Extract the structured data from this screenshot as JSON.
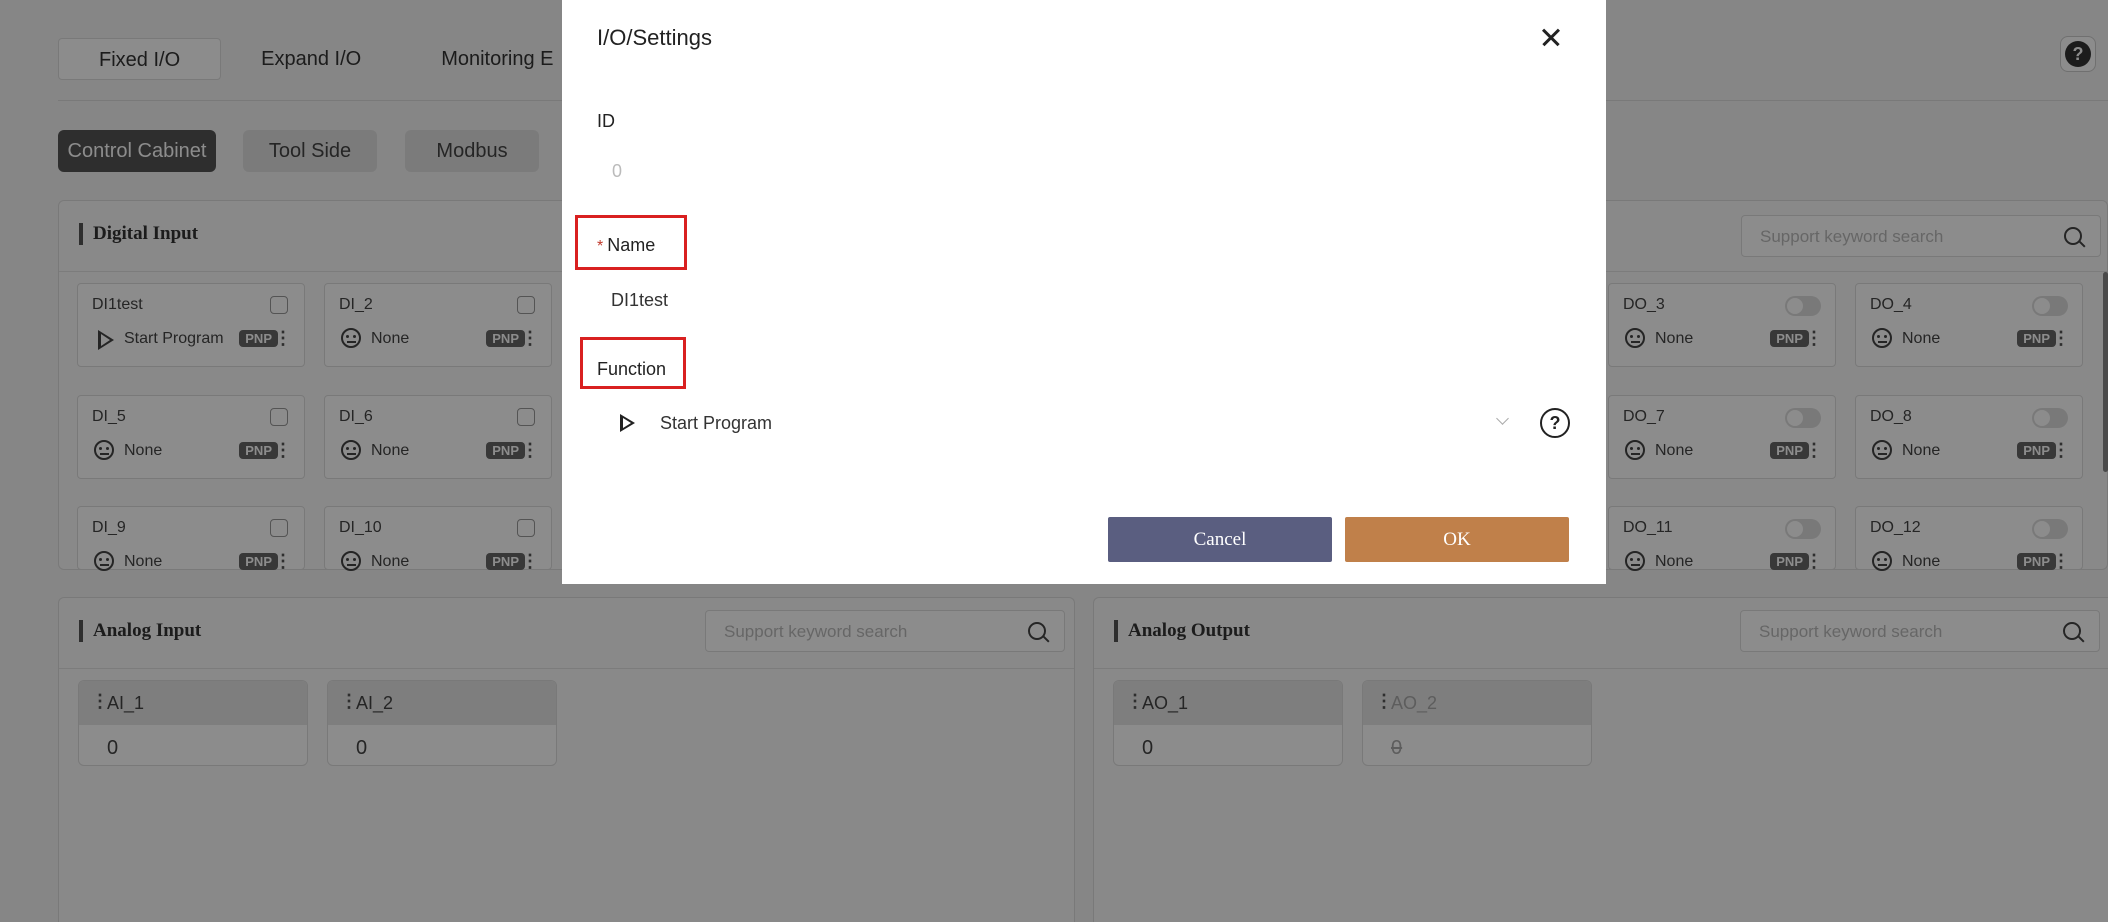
{
  "top_tabs": [
    "Fixed I/O",
    "Expand I/O",
    "Monitoring E"
  ],
  "sub_tabs": [
    "Control Cabinet",
    "Tool Side",
    "Modbus"
  ],
  "help_glyph": "?",
  "digital_input": {
    "title": "Digital Input",
    "search_placeholder": "Support keyword search",
    "items": [
      {
        "name": "DI1test",
        "function": "Start Program",
        "icon": "play-icon",
        "badge": "PNP"
      },
      {
        "name": "DI_2",
        "function": "None",
        "icon": "neutral-face-icon",
        "badge": "PNP"
      },
      {
        "name": "DI_5",
        "function": "None",
        "icon": "neutral-face-icon",
        "badge": "PNP"
      },
      {
        "name": "DI_6",
        "function": "None",
        "icon": "neutral-face-icon",
        "badge": "PNP"
      },
      {
        "name": "DI_9",
        "function": "None",
        "icon": "neutral-face-icon",
        "badge": "PNP"
      },
      {
        "name": "DI_10",
        "function": "None",
        "icon": "neutral-face-icon",
        "badge": "PNP"
      }
    ]
  },
  "digital_output": {
    "search_placeholder": "Support keyword search",
    "items": [
      {
        "name": "DO_3",
        "function": "None",
        "icon": "neutral-face-icon",
        "badge": "PNP"
      },
      {
        "name": "DO_4",
        "function": "None",
        "icon": "neutral-face-icon",
        "badge": "PNP"
      },
      {
        "name": "DO_7",
        "function": "None",
        "icon": "neutral-face-icon",
        "badge": "PNP"
      },
      {
        "name": "DO_8",
        "function": "None",
        "icon": "neutral-face-icon",
        "badge": "PNP"
      },
      {
        "name": "DO_11",
        "function": "None",
        "icon": "neutral-face-icon",
        "badge": "PNP"
      },
      {
        "name": "DO_12",
        "function": "None",
        "icon": "neutral-face-icon",
        "badge": "PNP"
      }
    ]
  },
  "analog_input": {
    "title": "Analog Input",
    "search_placeholder": "Support keyword search",
    "items": [
      {
        "name": "AI_1",
        "value": "0"
      },
      {
        "name": "AI_2",
        "value": "0"
      }
    ]
  },
  "analog_output": {
    "title": "Analog Output",
    "search_placeholder": "Support keyword search",
    "items": [
      {
        "name": "AO_1",
        "value": "0",
        "disabled": false
      },
      {
        "name": "AO_2",
        "value": "0",
        "disabled": true
      }
    ]
  },
  "modal": {
    "title": "I/O/Settings",
    "id_label": "ID",
    "id_value": "0",
    "name_required_mark": "*",
    "name_label": "Name",
    "name_value": "DI1test",
    "function_label": "Function",
    "function_value": "Start Program",
    "function_help": "?",
    "cancel_label": "Cancel",
    "ok_label": "OK"
  },
  "colors": {
    "highlight": "#d92020",
    "cancel_button": "#5a5e80",
    "ok_button": "#c0804a",
    "active_subtab": "#555555"
  }
}
